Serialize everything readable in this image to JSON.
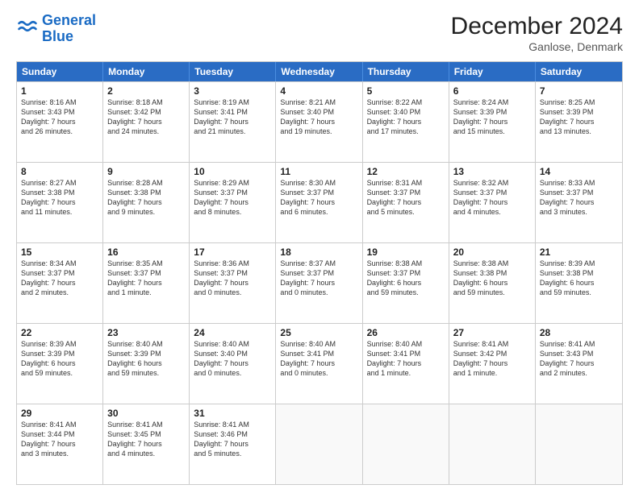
{
  "header": {
    "logo_general": "General",
    "logo_blue": "Blue",
    "month_title": "December 2024",
    "location": "Ganlose, Denmark"
  },
  "days_of_week": [
    "Sunday",
    "Monday",
    "Tuesday",
    "Wednesday",
    "Thursday",
    "Friday",
    "Saturday"
  ],
  "weeks": [
    [
      {
        "day": "1",
        "lines": [
          "Sunrise: 8:16 AM",
          "Sunset: 3:43 PM",
          "Daylight: 7 hours",
          "and 26 minutes."
        ]
      },
      {
        "day": "2",
        "lines": [
          "Sunrise: 8:18 AM",
          "Sunset: 3:42 PM",
          "Daylight: 7 hours",
          "and 24 minutes."
        ]
      },
      {
        "day": "3",
        "lines": [
          "Sunrise: 8:19 AM",
          "Sunset: 3:41 PM",
          "Daylight: 7 hours",
          "and 21 minutes."
        ]
      },
      {
        "day": "4",
        "lines": [
          "Sunrise: 8:21 AM",
          "Sunset: 3:40 PM",
          "Daylight: 7 hours",
          "and 19 minutes."
        ]
      },
      {
        "day": "5",
        "lines": [
          "Sunrise: 8:22 AM",
          "Sunset: 3:40 PM",
          "Daylight: 7 hours",
          "and 17 minutes."
        ]
      },
      {
        "day": "6",
        "lines": [
          "Sunrise: 8:24 AM",
          "Sunset: 3:39 PM",
          "Daylight: 7 hours",
          "and 15 minutes."
        ]
      },
      {
        "day": "7",
        "lines": [
          "Sunrise: 8:25 AM",
          "Sunset: 3:39 PM",
          "Daylight: 7 hours",
          "and 13 minutes."
        ]
      }
    ],
    [
      {
        "day": "8",
        "lines": [
          "Sunrise: 8:27 AM",
          "Sunset: 3:38 PM",
          "Daylight: 7 hours",
          "and 11 minutes."
        ]
      },
      {
        "day": "9",
        "lines": [
          "Sunrise: 8:28 AM",
          "Sunset: 3:38 PM",
          "Daylight: 7 hours",
          "and 9 minutes."
        ]
      },
      {
        "day": "10",
        "lines": [
          "Sunrise: 8:29 AM",
          "Sunset: 3:37 PM",
          "Daylight: 7 hours",
          "and 8 minutes."
        ]
      },
      {
        "day": "11",
        "lines": [
          "Sunrise: 8:30 AM",
          "Sunset: 3:37 PM",
          "Daylight: 7 hours",
          "and 6 minutes."
        ]
      },
      {
        "day": "12",
        "lines": [
          "Sunrise: 8:31 AM",
          "Sunset: 3:37 PM",
          "Daylight: 7 hours",
          "and 5 minutes."
        ]
      },
      {
        "day": "13",
        "lines": [
          "Sunrise: 8:32 AM",
          "Sunset: 3:37 PM",
          "Daylight: 7 hours",
          "and 4 minutes."
        ]
      },
      {
        "day": "14",
        "lines": [
          "Sunrise: 8:33 AM",
          "Sunset: 3:37 PM",
          "Daylight: 7 hours",
          "and 3 minutes."
        ]
      }
    ],
    [
      {
        "day": "15",
        "lines": [
          "Sunrise: 8:34 AM",
          "Sunset: 3:37 PM",
          "Daylight: 7 hours",
          "and 2 minutes."
        ]
      },
      {
        "day": "16",
        "lines": [
          "Sunrise: 8:35 AM",
          "Sunset: 3:37 PM",
          "Daylight: 7 hours",
          "and 1 minute."
        ]
      },
      {
        "day": "17",
        "lines": [
          "Sunrise: 8:36 AM",
          "Sunset: 3:37 PM",
          "Daylight: 7 hours",
          "and 0 minutes."
        ]
      },
      {
        "day": "18",
        "lines": [
          "Sunrise: 8:37 AM",
          "Sunset: 3:37 PM",
          "Daylight: 7 hours",
          "and 0 minutes."
        ]
      },
      {
        "day": "19",
        "lines": [
          "Sunrise: 8:38 AM",
          "Sunset: 3:37 PM",
          "Daylight: 6 hours",
          "and 59 minutes."
        ]
      },
      {
        "day": "20",
        "lines": [
          "Sunrise: 8:38 AM",
          "Sunset: 3:38 PM",
          "Daylight: 6 hours",
          "and 59 minutes."
        ]
      },
      {
        "day": "21",
        "lines": [
          "Sunrise: 8:39 AM",
          "Sunset: 3:38 PM",
          "Daylight: 6 hours",
          "and 59 minutes."
        ]
      }
    ],
    [
      {
        "day": "22",
        "lines": [
          "Sunrise: 8:39 AM",
          "Sunset: 3:39 PM",
          "Daylight: 6 hours",
          "and 59 minutes."
        ]
      },
      {
        "day": "23",
        "lines": [
          "Sunrise: 8:40 AM",
          "Sunset: 3:39 PM",
          "Daylight: 6 hours",
          "and 59 minutes."
        ]
      },
      {
        "day": "24",
        "lines": [
          "Sunrise: 8:40 AM",
          "Sunset: 3:40 PM",
          "Daylight: 7 hours",
          "and 0 minutes."
        ]
      },
      {
        "day": "25",
        "lines": [
          "Sunrise: 8:40 AM",
          "Sunset: 3:41 PM",
          "Daylight: 7 hours",
          "and 0 minutes."
        ]
      },
      {
        "day": "26",
        "lines": [
          "Sunrise: 8:40 AM",
          "Sunset: 3:41 PM",
          "Daylight: 7 hours",
          "and 1 minute."
        ]
      },
      {
        "day": "27",
        "lines": [
          "Sunrise: 8:41 AM",
          "Sunset: 3:42 PM",
          "Daylight: 7 hours",
          "and 1 minute."
        ]
      },
      {
        "day": "28",
        "lines": [
          "Sunrise: 8:41 AM",
          "Sunset: 3:43 PM",
          "Daylight: 7 hours",
          "and 2 minutes."
        ]
      }
    ],
    [
      {
        "day": "29",
        "lines": [
          "Sunrise: 8:41 AM",
          "Sunset: 3:44 PM",
          "Daylight: 7 hours",
          "and 3 minutes."
        ]
      },
      {
        "day": "30",
        "lines": [
          "Sunrise: 8:41 AM",
          "Sunset: 3:45 PM",
          "Daylight: 7 hours",
          "and 4 minutes."
        ]
      },
      {
        "day": "31",
        "lines": [
          "Sunrise: 8:41 AM",
          "Sunset: 3:46 PM",
          "Daylight: 7 hours",
          "and 5 minutes."
        ]
      },
      {
        "day": "",
        "lines": []
      },
      {
        "day": "",
        "lines": []
      },
      {
        "day": "",
        "lines": []
      },
      {
        "day": "",
        "lines": []
      }
    ]
  ]
}
